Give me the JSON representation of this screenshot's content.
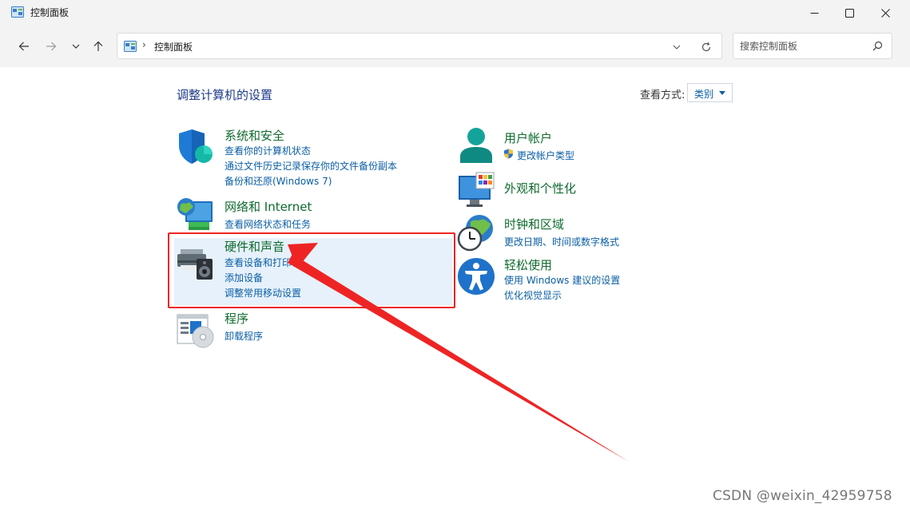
{
  "window": {
    "title": "控制面板",
    "minimize_icon": "minimize-icon",
    "maximize_icon": "maximize-icon",
    "close_icon": "close-icon"
  },
  "nav": {
    "address": "控制面板",
    "search_placeholder": "搜索控制面板"
  },
  "main": {
    "heading": "调整计算机的设置",
    "view_by_label": "查看方式:",
    "view_by_value": "类别"
  },
  "categories": {
    "system": {
      "title": "系统和安全",
      "icon": "shield-icon",
      "links": [
        "查看你的计算机状态",
        "通过文件历史记录保存你的文件备份副本",
        "备份和还原(Windows 7)"
      ]
    },
    "network": {
      "title": "网络和 Internet",
      "icon": "network-globe-icon",
      "links": [
        "查看网络状态和任务"
      ]
    },
    "hardware": {
      "title": "硬件和声音",
      "icon": "printer-speaker-icon",
      "links": [
        "查看设备和打印机",
        "添加设备",
        "调整常用移动设置"
      ]
    },
    "programs": {
      "title": "程序",
      "icon": "programs-disc-icon",
      "links": [
        "卸载程序"
      ]
    },
    "user": {
      "title": "用户帐户",
      "icon": "user-icon",
      "links": [
        "更改帐户类型"
      ]
    },
    "appearance": {
      "title": "外观和个性化",
      "icon": "monitor-palette-icon",
      "links": []
    },
    "clock": {
      "title": "时钟和区域",
      "icon": "clock-globe-icon",
      "links": [
        "更改日期、时间或数字格式"
      ]
    },
    "ease": {
      "title": "轻松使用",
      "icon": "accessibility-icon",
      "links": [
        "使用 Windows 建议的设置",
        "优化视觉显示"
      ]
    }
  },
  "watermark": "CSDN @weixin_42959758",
  "colors": {
    "category_title": "#0f6b2e",
    "link": "#0b5fa5",
    "heading": "#1e3a8a",
    "annotation_red": "#ee2424",
    "highlight": "#e6f1fb"
  }
}
